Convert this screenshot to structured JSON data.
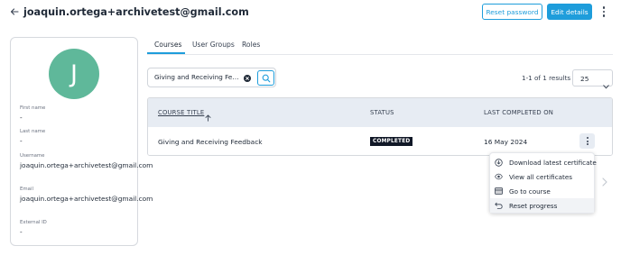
{
  "header": {
    "title": "joaquin.ortega+archivetest@gmail.com",
    "reset_password_label": "Reset password",
    "edit_details_label": "Edit details"
  },
  "profile": {
    "avatar_letter": "J",
    "avatar_color": "#5fb89a",
    "fields": [
      {
        "label": "First name",
        "value": "-"
      },
      {
        "label": "Last name",
        "value": "-"
      },
      {
        "label": "Username",
        "value": "joaquin.ortega+archivetest@gmail.com"
      },
      {
        "label": "Email",
        "value": "joaquin.ortega+archivetest@gmail.com"
      },
      {
        "label": "External ID",
        "value": "-"
      }
    ]
  },
  "tabs": [
    {
      "label": "Courses",
      "active": true
    },
    {
      "label": "User Groups",
      "active": false
    },
    {
      "label": "Roles",
      "active": false
    }
  ],
  "search": {
    "value": "Giving and Receiving Feedback"
  },
  "pagination": {
    "results_text": "1-1 of 1 results",
    "page_size": "25"
  },
  "table": {
    "columns": [
      "COURSE TITLE",
      "STATUS",
      "LAST COMPLETED ON"
    ],
    "sort_icon": "arrow-up-icon",
    "rows": [
      {
        "title": "Giving and Receiving Feedback",
        "status": "COMPLETED",
        "last_completed": "16 May 2024"
      }
    ]
  },
  "row_menu": {
    "items": [
      {
        "label": "Download latest certificate",
        "icon": "download-icon"
      },
      {
        "label": "View all certificates",
        "icon": "eye-icon"
      },
      {
        "label": "Go to course",
        "icon": "course-icon"
      },
      {
        "label": "Reset progress",
        "icon": "undo-icon"
      }
    ]
  },
  "colors": {
    "accent": "#1e9ddb",
    "table_header_bg": "#e7ecf3",
    "badge_bg": "#111827"
  }
}
